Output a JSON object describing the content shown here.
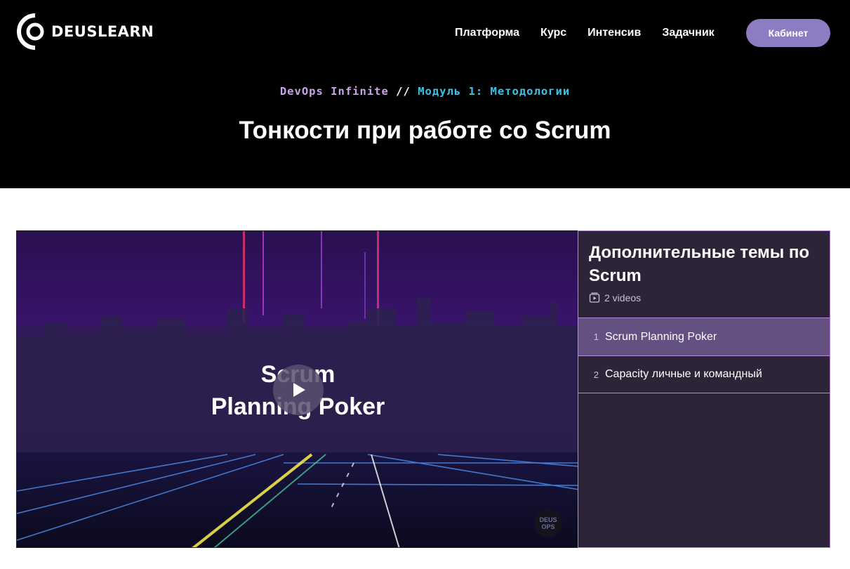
{
  "brand": {
    "name": "DEUSLEARN"
  },
  "nav": {
    "items": [
      "Платформа",
      "Курс",
      "Интенсив",
      "Задачник"
    ],
    "cabinet_label": "Кабинет"
  },
  "breadcrumb": {
    "course": "DevOps Infinite",
    "separator": "//",
    "module": "Модуль 1: Методологии"
  },
  "page": {
    "title": "Тонкости при работе со Scrum"
  },
  "video": {
    "title_line1": "Scrum",
    "title_line2": "Planning Poker",
    "badge_line1": "DEUS",
    "badge_line2": "OPS"
  },
  "playlist": {
    "title": "Дополнительные темы по Scrum",
    "count": "2 videos",
    "items": [
      {
        "number": "1",
        "label": "Scrum Planning Poker",
        "active": true
      },
      {
        "number": "2",
        "label": "Capacity личные и командный",
        "active": false
      }
    ]
  },
  "colors": {
    "accent": "#8e7cc3",
    "breadcrumb_course": "#c9a4e6",
    "breadcrumb_module": "#3ec1e6",
    "playlist_bg": "#2e2437",
    "playlist_active": "#655082"
  }
}
